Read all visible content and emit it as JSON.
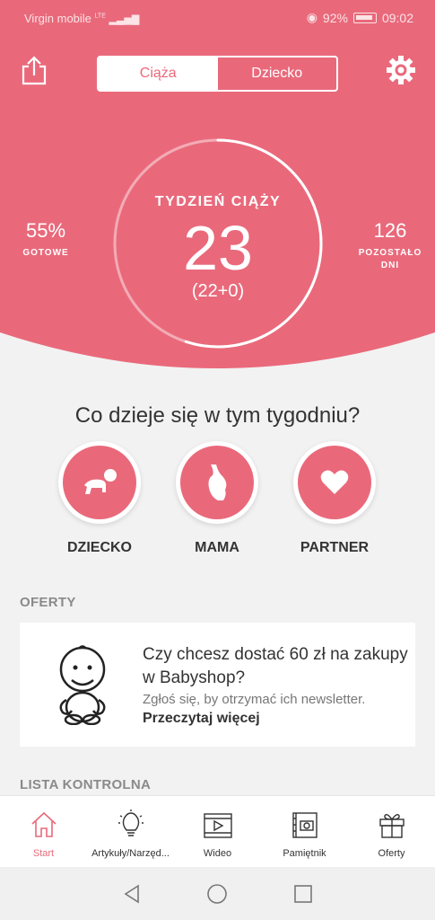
{
  "status_bar": {
    "carrier": "Virgin mobile",
    "network": "LTE",
    "battery_percent": "92%",
    "time": "09:02"
  },
  "header": {
    "share_icon": "share-icon",
    "settings_icon": "gear-icon",
    "toggle": {
      "left_label": "Ciąża",
      "right_label": "Dziecko",
      "active": "left"
    }
  },
  "progress": {
    "title": "TYDZIEŃ CIĄŻY",
    "week": "23",
    "detail": "(22+0)",
    "done_value": "55%",
    "done_label": "GOTOWE",
    "remaining_value": "126",
    "remaining_label": "POZOSTAŁO DNI",
    "fraction_complete": 0.55
  },
  "week_section": {
    "question": "Co dzieje się w tym tygodniu?",
    "categories": [
      {
        "label": "DZIECKO",
        "icon": "crawling-baby-icon"
      },
      {
        "label": "MAMA",
        "icon": "pregnant-belly-icon"
      },
      {
        "label": "PARTNER",
        "icon": "heart-icon"
      }
    ]
  },
  "offers": {
    "section_title": "OFERTY",
    "card": {
      "icon": "baby-outline-icon",
      "headline": "Czy chcesz dostać 60 zł na zakupy w Babyshop?",
      "subtitle": "Zgłoś się, by otrzymać ich newsletter.",
      "link": "Przeczytaj więcej"
    }
  },
  "checklist": {
    "section_title": "LISTA KONTROLNA"
  },
  "tabbar": {
    "items": [
      {
        "label": "Start",
        "icon": "home-icon",
        "active": true
      },
      {
        "label": "Artykuły/Narzęd...",
        "icon": "lightbulb-icon",
        "active": false
      },
      {
        "label": "Wideo",
        "icon": "video-icon",
        "active": false
      },
      {
        "label": "Pamiętnik",
        "icon": "photo-album-icon",
        "active": false
      },
      {
        "label": "Oferty",
        "icon": "gift-icon",
        "active": false
      }
    ]
  },
  "colors": {
    "accent": "#e9697b",
    "background": "#f2f2f2",
    "text": "#333333"
  }
}
